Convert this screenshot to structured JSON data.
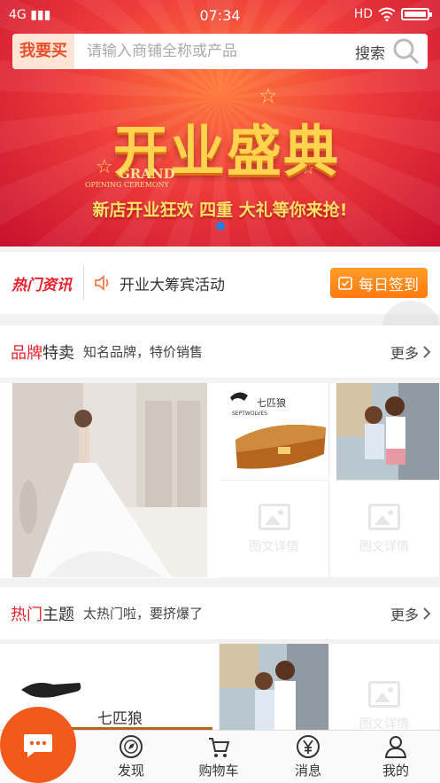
{
  "status": {
    "network": "4G",
    "time": "07:34",
    "hd": "HD"
  },
  "search": {
    "category": "我要买",
    "placeholder": "请输入商铺全称或产品",
    "button": "搜索"
  },
  "banner": {
    "title": "开业盛典",
    "en_line1": "GRAND",
    "en_line2": "OPENING CEREMONY",
    "subtitle": "新店开业狂欢 四重 大礼等你来抢!"
  },
  "news": {
    "tag": "热门资讯",
    "text": "开业大筹宾活动",
    "signin": "每日签到"
  },
  "brand_section": {
    "title_red": "品牌",
    "title_black": "特卖",
    "subtitle": "知名品牌，特价销售",
    "more": "更多"
  },
  "hot_section": {
    "title_red": "热门",
    "title_black": "主题",
    "subtitle": "太热门啦，要挤爆了",
    "more": "更多"
  },
  "products": {
    "brand_name": "七匹狼",
    "brand_en": "SEPTWOLVES",
    "placeholder_text": "图文详情"
  },
  "tabs": [
    {
      "label": "发现",
      "icon": "compass-icon"
    },
    {
      "label": "购物车",
      "icon": "cart-icon"
    },
    {
      "label": "消息",
      "icon": "yen-icon"
    },
    {
      "label": "我的",
      "icon": "user-icon"
    }
  ],
  "colors": {
    "accent": "#e8212a",
    "signin": "#ff7a0f",
    "fab": "#f25a1b",
    "banner": "#ef3b3b"
  }
}
